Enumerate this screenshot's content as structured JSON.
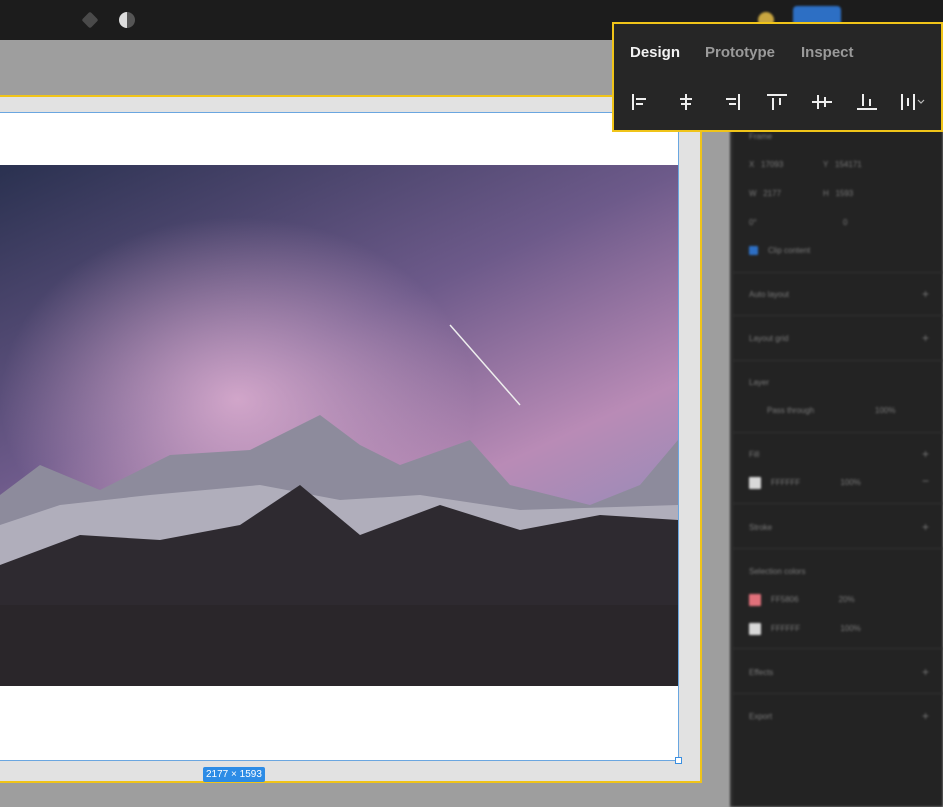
{
  "canvas": {
    "dimension_label": "2177 × 1593"
  },
  "popover": {
    "tabs": [
      {
        "label": "Design",
        "active": true
      },
      {
        "label": "Prototype",
        "active": false
      },
      {
        "label": "Inspect",
        "active": false
      }
    ],
    "align_icons": [
      "align-left-icon",
      "align-horizontal-center-icon",
      "align-right-icon",
      "align-top-icon",
      "align-vertical-center-icon",
      "align-bottom-icon",
      "distribute-icon"
    ]
  },
  "panel": {
    "frame_label": "Frame",
    "x": "17093",
    "y": "154171",
    "w": "2177",
    "h": "1593",
    "rotation": "0°",
    "radius": "0",
    "clip_content": "Clip content",
    "auto_layout": "Auto layout",
    "layout_grid": "Layout grid",
    "layer": "Layer",
    "blend": "Pass through",
    "layer_opacity": "100%",
    "fill": "Fill",
    "fill_hex": "FFFFFF",
    "fill_opacity": "100%",
    "stroke": "Stroke",
    "selection_colors": "Selection colors",
    "sel": [
      {
        "hex": "FF5806",
        "opacity": "20%",
        "color": "#e0707a"
      },
      {
        "hex": "FFFFFF",
        "opacity": "100%",
        "color": "#d8d8d8"
      }
    ],
    "effects": "Effects",
    "export": "Export"
  },
  "colors": {
    "accent": "#2d8ce6",
    "highlight": "#f0c419"
  }
}
